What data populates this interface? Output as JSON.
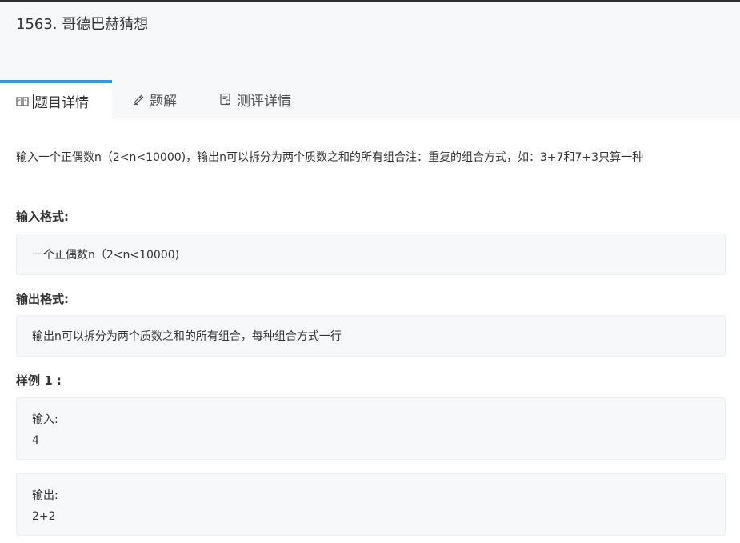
{
  "problem": {
    "title": "1563. 哥德巴赫猜想"
  },
  "tabs": [
    {
      "label": "题目详情",
      "icon": "book-icon",
      "active": true
    },
    {
      "label": "题解",
      "icon": "pen-icon",
      "active": false
    },
    {
      "label": "测评详情",
      "icon": "report-icon",
      "active": false
    }
  ],
  "description": "输入一个正偶数n（2<n<10000)，输出n可以拆分为两个质数之和的所有组合注：重复的组合方式，如：3+7和7+3只算一种",
  "input_format": {
    "label": "输入格式:",
    "content": "一个正偶数n（2<n<10000)"
  },
  "output_format": {
    "label": "输出格式:",
    "content": "输出n可以拆分为两个质数之和的所有组合，每种组合方式一行"
  },
  "sample": {
    "label": "样例 1 :",
    "input_label": "输入:",
    "input_value": "4",
    "output_label": "输出:",
    "output_value": "2+2"
  },
  "colors": {
    "accent": "#1e9ff2",
    "header_bg": "#f7f8fa",
    "box_bg": "#f7f8fa"
  }
}
